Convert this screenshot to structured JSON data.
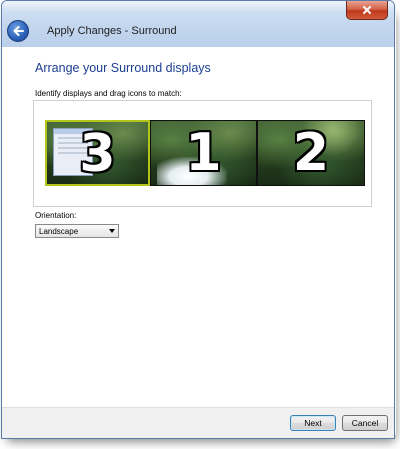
{
  "window": {
    "title": "Apply Changes - Surround"
  },
  "content": {
    "heading": "Arrange your Surround displays",
    "instruction": "Identify displays and drag icons to match:",
    "monitors": [
      {
        "number": "3",
        "selected": true
      },
      {
        "number": "1",
        "selected": false
      },
      {
        "number": "2",
        "selected": false
      }
    ],
    "orientation": {
      "label": "Orientation:",
      "selected": "Landscape"
    }
  },
  "footer": {
    "next_label": "Next",
    "cancel_label": "Cancel"
  },
  "colors": {
    "heading": "#1b3f91",
    "selection": "#b3c41a",
    "close": "#c0391d"
  },
  "icons": {
    "back": "back-arrow-icon",
    "close": "close-icon",
    "dropdown": "dropdown-arrow-icon"
  }
}
